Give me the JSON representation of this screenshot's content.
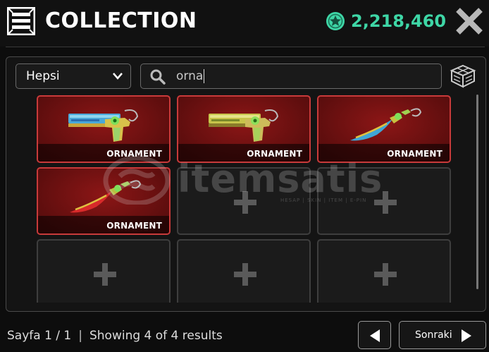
{
  "header": {
    "title": "COLLECTION",
    "currency_value": "2,218,460",
    "currency_icon": "star-coin-icon",
    "accent_color": "#3ed6a6"
  },
  "filters": {
    "category_value": "Hepsi",
    "search_value": "orna"
  },
  "grid": {
    "items": [
      {
        "label": "ORNAMENT",
        "art": "pistol-blue-yellow"
      },
      {
        "label": "ORNAMENT",
        "art": "pistol-gold-green"
      },
      {
        "label": "ORNAMENT",
        "art": "knife-blue-green"
      },
      {
        "label": "ORNAMENT",
        "art": "knife-red-green"
      }
    ],
    "empty_slots": 5,
    "filled_border_color": "#c83a3a"
  },
  "watermark": {
    "text": "itemsatis",
    "subtext": "HESAP | SKIN | ITEM | E-PIN"
  },
  "footer": {
    "page": "Sayfa 1 / 1",
    "separator": "|",
    "results": "Showing 4 of 4 results",
    "next_label": "Sonraki"
  }
}
